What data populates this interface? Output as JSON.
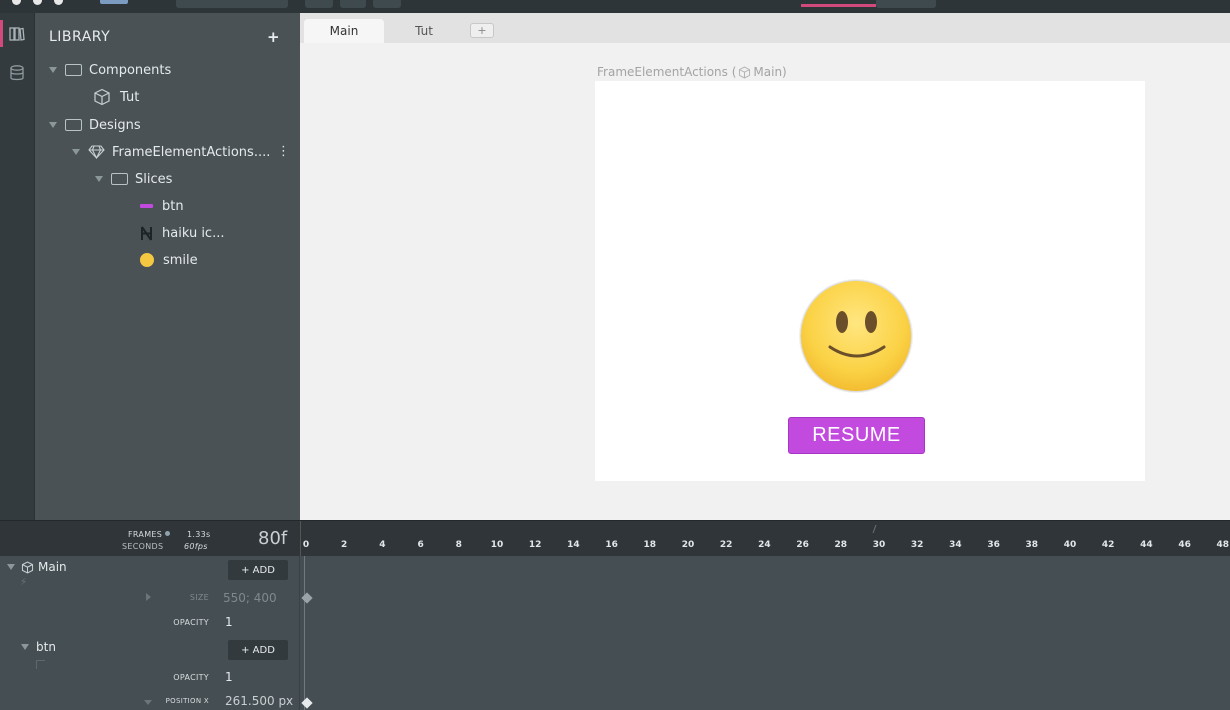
{
  "topbar": {
    "accent": "#d24a7c"
  },
  "rail": {
    "icons": [
      "library-icon",
      "database-icon"
    ]
  },
  "library": {
    "title": "LIBRARY",
    "add_label": "+",
    "items": [
      {
        "label": "Components",
        "kind": "folder"
      },
      {
        "label": "Tut",
        "kind": "component"
      },
      {
        "label": "Designs",
        "kind": "folder"
      },
      {
        "label": "FrameElementActions....",
        "kind": "design"
      },
      {
        "label": "Slices",
        "kind": "folder"
      },
      {
        "label": "btn",
        "kind": "slice"
      },
      {
        "label": "haiku ic...",
        "kind": "slice"
      },
      {
        "label": "smile",
        "kind": "slice"
      }
    ],
    "kebab": "⋮"
  },
  "stage": {
    "tabs": [
      {
        "label": "Main"
      },
      {
        "label": "Tut"
      }
    ],
    "tab_add": "+",
    "canvas_label_a": "FrameElementActions (",
    "canvas_label_b": "Main)",
    "button_label": "RESUME",
    "button_color": "#c34adf"
  },
  "timeline": {
    "frames_label": "FRAMES",
    "seconds_label": "SECONDS",
    "time_value": "1.33s",
    "fps_value": "60fps",
    "frame_count": "80f",
    "ticks": [
      "0",
      "2",
      "4",
      "6",
      "8",
      "10",
      "12",
      "14",
      "16",
      "18",
      "20",
      "22",
      "24",
      "26",
      "28",
      "30",
      "32",
      "34",
      "36",
      "38",
      "40",
      "42",
      "44",
      "46",
      "48"
    ],
    "rows": {
      "main_label": "Main",
      "add_label": "+ ADD",
      "size_label": "SIZE",
      "size_value": "550; 400",
      "opacity_label": "OPACITY",
      "opacity_value": "1",
      "btn_label": "btn",
      "btn_opacity_label": "OPACITY",
      "btn_opacity_value": "1",
      "posx_label": "POSITION X",
      "posx_value": "261.500 px"
    }
  }
}
